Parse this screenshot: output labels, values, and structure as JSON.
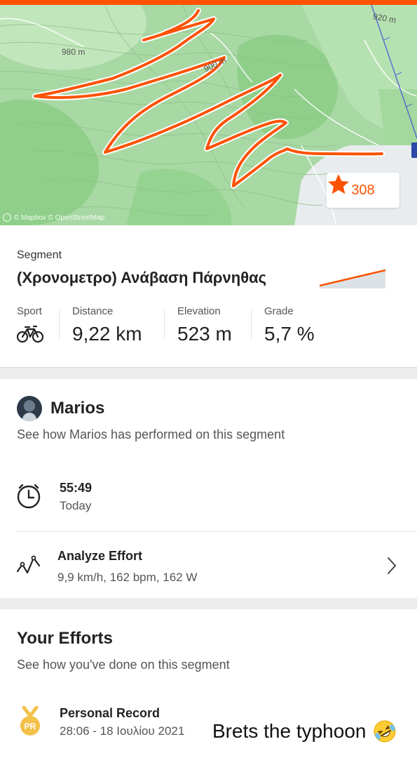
{
  "map": {
    "contour_labels": [
      "980 m",
      "900 m",
      "920 m"
    ],
    "attribution": "© Mapbox © OpenStreetMap",
    "star_count": "308",
    "colors": {
      "route": "#fc5200",
      "forest": "#8fcf8a",
      "meadow": "#b6e2b1",
      "urban": "#e9ecef"
    }
  },
  "segment": {
    "kicker": "Segment",
    "title": "(Χρονομετρο) Ανάβαση Πάρνηθας",
    "stats": [
      {
        "label": "Sport",
        "value": "",
        "icon": "bike-icon"
      },
      {
        "label": "Distance",
        "value": "9,22 km"
      },
      {
        "label": "Elevation",
        "value": "523 m"
      },
      {
        "label": "Grade",
        "value": "5,7 %"
      }
    ]
  },
  "athlete": {
    "name": "Marios",
    "subtitle": "See how Marios has performed on this segment",
    "time": "55:49",
    "when": "Today",
    "analyze_title": "Analyze Effort",
    "analyze_sub": "9,9 km/h, 162 bpm, 162 W"
  },
  "efforts": {
    "title": "Your Efforts",
    "subtitle": "See how you've done on this segment",
    "pr_badge": "PR",
    "pr_title": "Personal Record",
    "pr_detail": "28:06 - 18 Ιουλίου 2021"
  },
  "caption": {
    "text": "Brets the typhoon",
    "emoji": "rolling-on-floor-laughing-emoji"
  },
  "accent": "#fc5200"
}
